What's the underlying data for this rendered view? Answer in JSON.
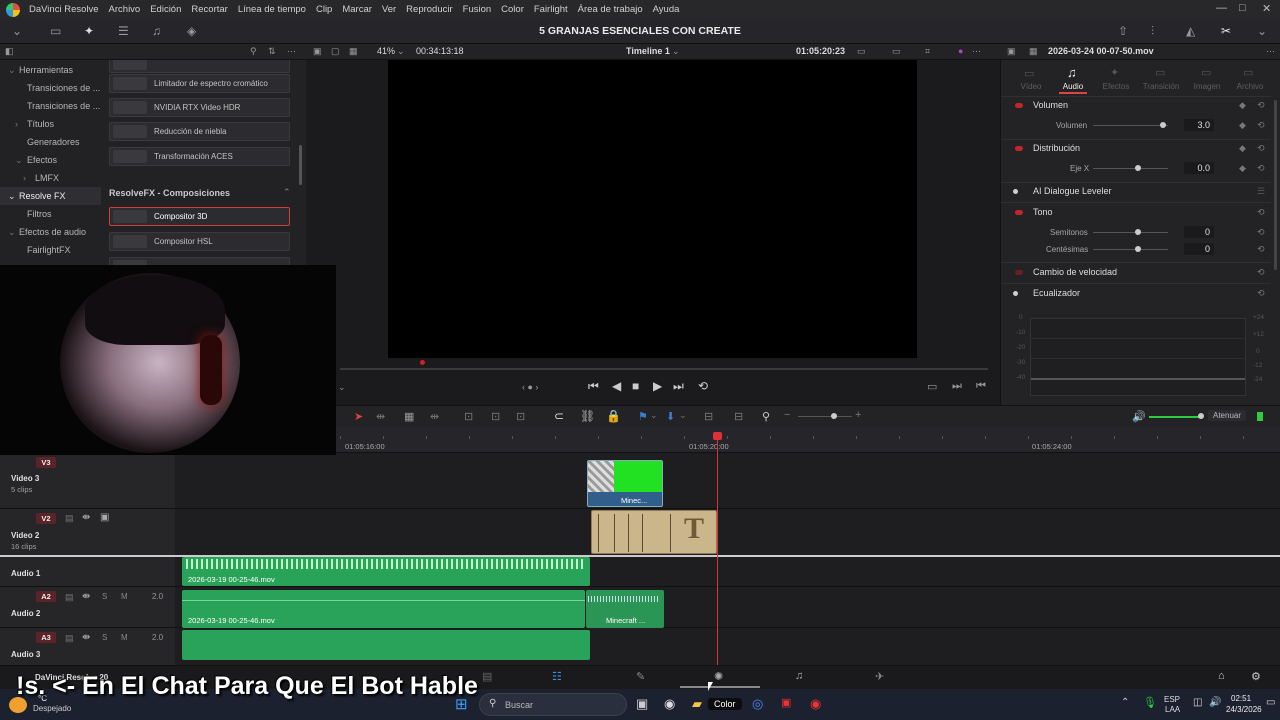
{
  "menu": {
    "app": "DaVinci Resolve",
    "items": [
      "Archivo",
      "Edición",
      "Recortar",
      "Línea de tiempo",
      "Clip",
      "Marcar",
      "Ver",
      "Reproducir",
      "Fusion",
      "Color",
      "Fairlight",
      "Área de trabajo",
      "Ayuda"
    ]
  },
  "project_title": "5 GRANJAS ESENCIALES CON CREATE",
  "subbar": {
    "zoom": "41%",
    "source_tc": "00:34:13:18",
    "timeline": "Timeline 1",
    "record_tc": "01:05:20:23",
    "clip_name": "2026-03-24 00-07-50.mov"
  },
  "nav": {
    "herramientas": "Herramientas",
    "transiciones1": "Transiciones de ...",
    "transiciones2": "Transiciones de ...",
    "titulos": "Títulos",
    "generadores": "Generadores",
    "efectos": "Efectos",
    "lmfx": "LMFX",
    "resolvefx": "Resolve FX",
    "filtros": "Filtros",
    "efectos_audio": "Efectos de audio",
    "fairlightfx": "FairlightFX"
  },
  "fx": {
    "item0": "Limitador de espectro cromático",
    "item1": "NVIDIA RTX Video HDR",
    "item2": "Reducción de niebla",
    "item3": "Transformación ACES",
    "section": "ResolveFX - Composiciones",
    "item4": "Compositor 3D",
    "item5": "Compositor HSL"
  },
  "inspector": {
    "tabs": [
      "Vídeo",
      "Audio",
      "Efectos",
      "Transición",
      "Imagen",
      "Archivo"
    ],
    "volumen": "Volumen",
    "volumen_sub": "Volumen",
    "volumen_val": "3.0",
    "distribucion": "Distribución",
    "ejex": "Eje X",
    "ejex_val": "0.0",
    "ai": "AI Dialogue Leveler",
    "tono": "Tono",
    "semitonos": "Semitonos",
    "semitonos_val": "0",
    "centesimas": "Centésimas",
    "centesimas_val": "0",
    "velocidad": "Cambio de velocidad",
    "ecualizador": "Ecualizador",
    "eq_ticks": [
      "+24",
      "+12",
      "0",
      "-12",
      "-24"
    ],
    "eq_ticks_left": [
      "0",
      "-10",
      "-20",
      "-30",
      "-40"
    ]
  },
  "timeline": {
    "tc1": "01:05:16:00",
    "tc2": "01:05:20:00",
    "tc3": "01:05:24:00",
    "atenuar": "Atenuar"
  },
  "tracks": {
    "v3": "V3",
    "video3": "Video 3",
    "video3_sub": "5 clips",
    "v2": "V2",
    "video2": "Video 2",
    "video2_sub": "16 clips",
    "audio1": "Audio 1",
    "a2": "A2",
    "audio2": "Audio 2",
    "a3": "A3",
    "audio3": "Audio 3",
    "vol2": "2.0",
    "vol3": "2.0",
    "s": "S",
    "m": "M"
  },
  "clips": {
    "a1": "2026-03-19 00-25-46.mov",
    "a2": "2026-03-19 00-25-46.mov",
    "a2b": "Minecraft ...",
    "v3": "Minec...",
    "title_t": "T"
  },
  "pagebar": {
    "app": "DaVinci Resolve 20"
  },
  "taskbar": {
    "weather_temp": "°C",
    "weather": "Despejado",
    "search": "Buscar",
    "color_app": "Color",
    "lang1": "ESP",
    "lang2": "LAA",
    "time": "02:51",
    "date": "24/3/2026"
  },
  "overlay": "!s. <- En El Chat Para Que El Bot Hable"
}
